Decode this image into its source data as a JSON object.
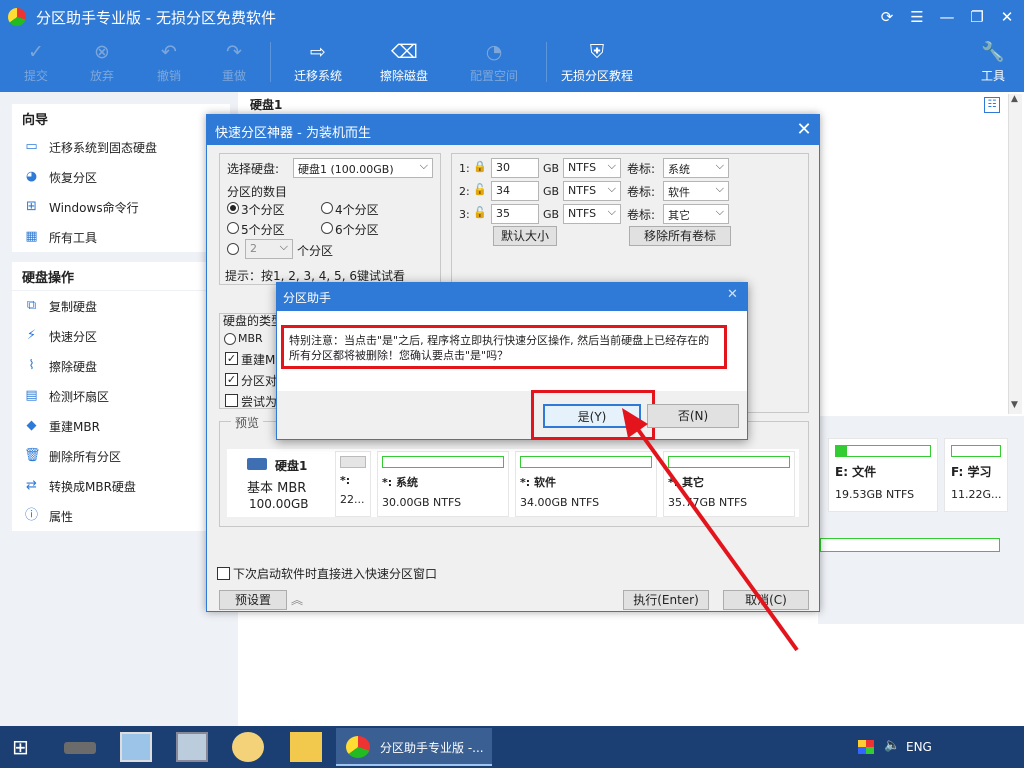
{
  "app": {
    "title": "分区助手专业版 - 无损分区免费软件"
  },
  "toolbar": {
    "items": [
      {
        "label": "提交",
        "icon": "check-icon"
      },
      {
        "label": "放弃",
        "icon": "discard-icon"
      },
      {
        "label": "撤销",
        "icon": "undo-icon"
      },
      {
        "label": "重做",
        "icon": "redo-icon"
      },
      {
        "label": "迁移系统",
        "icon": "migrate-os-icon"
      },
      {
        "label": "擦除磁盘",
        "icon": "wipe-disk-icon"
      },
      {
        "label": "配置空间",
        "icon": "allocate-space-icon"
      },
      {
        "label": "无损分区教程",
        "icon": "shield-icon"
      },
      {
        "label": "工具",
        "icon": "tools-icon"
      }
    ]
  },
  "sidebar": {
    "wizard_title": "向导",
    "wizard_items": [
      "迁移系统到固态硬盘",
      "恢复分区",
      "Windows命令行",
      "所有工具"
    ],
    "disk_ops_title": "硬盘操作",
    "disk_ops_items": [
      "复制硬盘",
      "快速分区",
      "擦除硬盘",
      "检测坏扇区",
      "重建MBR",
      "删除所有分区",
      "转换成MBR硬盘",
      "属性"
    ]
  },
  "main": {
    "disk_header": "硬盘1",
    "partitions": [
      {
        "name": "E: 文件",
        "info": "19.53GB NTFS",
        "fill": 0.12
      },
      {
        "name": "F: 学习",
        "info": "11.22G...",
        "fill": 0.0
      }
    ]
  },
  "quick_dialog": {
    "title": "快速分区神器 - 为装机而生",
    "select_disk_label": "选择硬盘:",
    "select_disk_value": "硬盘1 (100.00GB)",
    "count_label": "分区的数目",
    "opt3": "3个分区",
    "opt4": "4个分区",
    "opt5": "5个分区",
    "opt6": "6个分区",
    "custom_value": "2",
    "custom_suffix": "个分区",
    "hint": "提示：按1, 2, 3, 4, 5, 6键试试看",
    "rows": [
      {
        "idx": "1:",
        "size": "30",
        "unit": "GB",
        "fs": "NTFS",
        "vol_label": "卷标:",
        "vol": "系统"
      },
      {
        "idx": "2:",
        "size": "34",
        "unit": "GB",
        "fs": "NTFS",
        "vol_label": "卷标:",
        "vol": "软件"
      },
      {
        "idx": "3:",
        "size": "35",
        "unit": "GB",
        "fs": "NTFS",
        "vol_label": "卷标:",
        "vol": "其它"
      }
    ],
    "default_size_btn": "默认大小",
    "remove_labels_btn": "移除所有卷标",
    "disk_type_label": "硬盘的类型",
    "mbr_option": "MBR",
    "chk_rebuild": "重建MB",
    "chk_align": "分区对",
    "chk_try": "尝试为",
    "preview_label": "预览",
    "preview": {
      "disk_name": "硬盘1",
      "disk_type": "基本 MBR",
      "disk_size": "100.00GB",
      "cards": [
        {
          "name": "*:",
          "info": "22..."
        },
        {
          "name": "*: 系统",
          "info": "30.00GB NTFS"
        },
        {
          "name": "*: 软件",
          "info": "34.00GB NTFS"
        },
        {
          "name": "*: 其它",
          "info": "35.77GB NTFS"
        }
      ]
    },
    "next_start_label": "下次启动软件时直接进入快速分区窗口",
    "preset_btn": "预设置",
    "execute_btn": "执行(Enter)",
    "cancel_btn": "取消(C)"
  },
  "confirm_dialog": {
    "title": "分区助手",
    "message": "特别注意：当点击\"是\"之后, 程序将立即执行快速分区操作, 然后当前硬盘上已经存在的所有分区都将被删除！您确认要点击\"是\"吗？",
    "yes_btn": "是(Y)",
    "no_btn": "否(N)"
  },
  "taskbar": {
    "active_app": "分区助手专业版 -...",
    "lang": "ENG"
  },
  "colors": {
    "accent": "#2e7ad6",
    "highlight": "#e3141b",
    "bar": "#33cc33"
  }
}
